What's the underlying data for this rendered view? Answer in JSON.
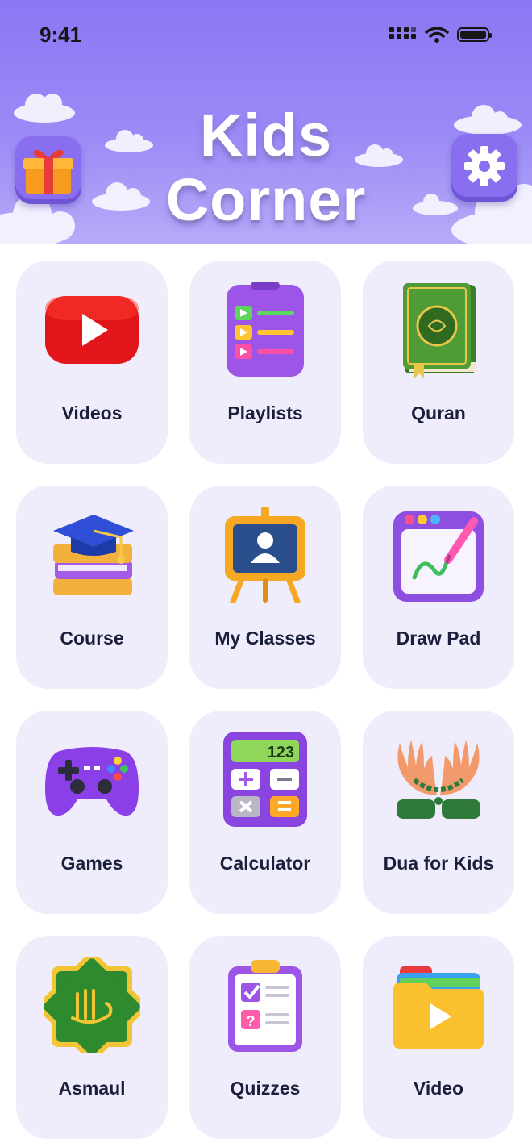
{
  "status_bar": {
    "time": "9:41"
  },
  "header": {
    "title_line1": "Kids",
    "title_line2": "Corner",
    "gift_icon": "gift-icon",
    "settings_icon": "gear-icon"
  },
  "menu": {
    "items": [
      {
        "label": "Videos",
        "icon": "youtube-play-icon"
      },
      {
        "label": "Playlists",
        "icon": "playlist-clipboard-icon"
      },
      {
        "label": "Quran",
        "icon": "quran-book-icon"
      },
      {
        "label": "Course",
        "icon": "graduation-books-icon"
      },
      {
        "label": "My Classes",
        "icon": "classroom-board-icon"
      },
      {
        "label": "Draw Pad",
        "icon": "draw-pad-icon"
      },
      {
        "label": "Games",
        "icon": "gamepad-icon"
      },
      {
        "label": "Calculator",
        "icon": "calculator-icon"
      },
      {
        "label": "Dua for Kids",
        "icon": "praying-hands-icon"
      },
      {
        "label": "Asmaul",
        "icon": "allah-emblem-icon"
      },
      {
        "label": "Quizzes",
        "icon": "quiz-clipboard-icon"
      },
      {
        "label": "Video",
        "icon": "video-folder-icon"
      }
    ],
    "calculator_display": "123"
  },
  "colors": {
    "header": "#8b77f4",
    "card_bg": "#efecfb",
    "label": "#1a1f3c"
  }
}
